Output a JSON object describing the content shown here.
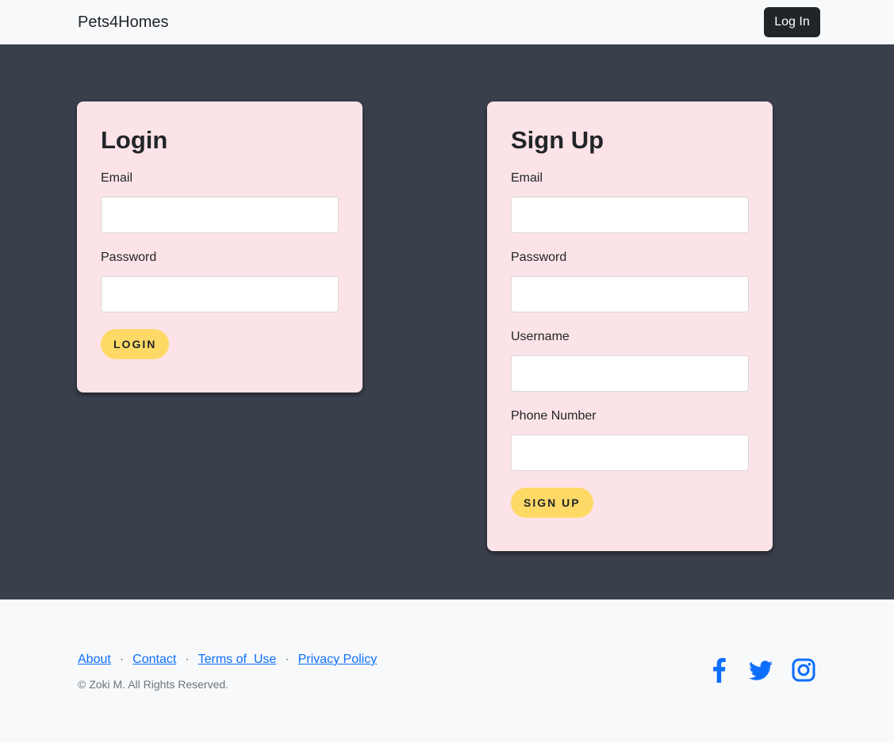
{
  "navbar": {
    "brand": "Pets4Homes",
    "login_button": "Log In"
  },
  "login_card": {
    "title": "Login",
    "email_label": "Email",
    "email_value": "",
    "password_label": "Password",
    "password_value": "",
    "submit_label": "LOGIN"
  },
  "signup_card": {
    "title": "Sign Up",
    "email_label": "Email",
    "email_value": "",
    "password_label": "Password",
    "password_value": "",
    "username_label": "Username",
    "username_value": "",
    "phone_label": "Phone Number",
    "phone_value": "",
    "submit_label": "SIGN UP"
  },
  "footer": {
    "links": [
      "About",
      "Contact",
      "Terms of  Use",
      "Privacy Policy"
    ],
    "separator": "·",
    "copyright": "© Zoki M. All Rights Reserved.",
    "social_icons": [
      "facebook-icon",
      "twitter-icon",
      "instagram-icon"
    ]
  },
  "colors": {
    "background_dark": "#3a3f4c",
    "card_pink": "#fce3e7",
    "button_yellow": "#ffd966",
    "link_blue": "#0d6efd",
    "navbar_button": "#212529"
  }
}
